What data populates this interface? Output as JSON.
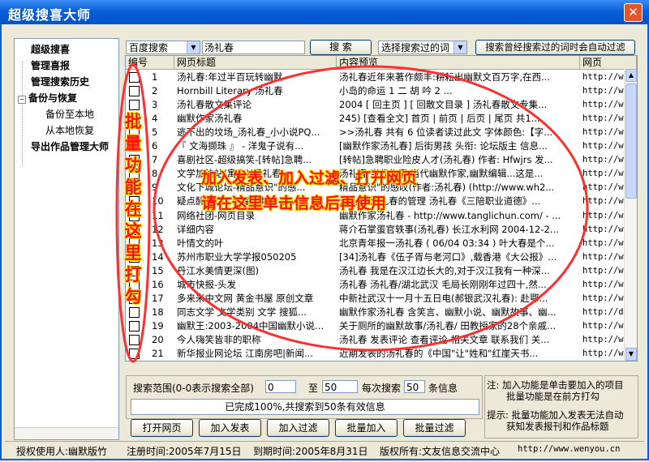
{
  "window": {
    "title": "超级搜喜大师",
    "close_symbol": "✕"
  },
  "sidebar": {
    "items": [
      {
        "label": "超级搜喜",
        "bold": true
      },
      {
        "label": "管理喜报",
        "bold": true
      },
      {
        "label": "管理搜索历史",
        "bold": true
      },
      {
        "label": "备份与恢复",
        "bold": true,
        "expander": "−"
      },
      {
        "label": "备份至本地",
        "bold": false
      },
      {
        "label": "从本地恢复",
        "bold": false
      },
      {
        "label": "导出作品管理大师",
        "bold": true
      }
    ]
  },
  "toolbar": {
    "engine": "百度搜索",
    "query": "汤礼春",
    "search_button": "搜 索",
    "history_select": "选择搜索过的词",
    "filter_button": "搜索曾经搜索过的词时会自动过滤"
  },
  "table": {
    "columns": [
      "编号",
      "网页标题",
      "内容预览",
      "网页"
    ],
    "rows": [
      {
        "n": "1",
        "title": "汤礼春:年过半百玩转幽默",
        "preview": "汤礼春近年来著作颇丰:耕耘出幽默文百万字,在西...",
        "url": "http://w"
      },
      {
        "n": "2",
        "title": "Hornbill Literary 汤礼春",
        "preview": "小岛的命运 1 二 胡 吟 2 ...",
        "url": "http://w"
      },
      {
        "n": "3",
        "title": "汤礼春散文集评论",
        "preview": "2004 [ 回主页 ] [ 回散文目录 ] 汤礼春散文专集...",
        "url": "http://w"
      },
      {
        "n": "4",
        "title": "幽默作家汤礼春",
        "preview": "245) [查看全文] 首页 | 前页 | 后页 | 尾页 共1...",
        "url": "http://w"
      },
      {
        "n": "5",
        "title": "逃不出的坟场_汤礼春_小小说PQ...",
        "preview": ">>汤礼春 共有 6 位读者读过此文 字体颜色:【字...",
        "url": "http://w"
      },
      {
        "n": "6",
        "title": "『 文海撷珠 』 - 洋鬼子说有...",
        "preview": "[幽默作家汤礼春] 后街男孩 头衔: 论坛版主 信息...",
        "url": "http://w"
      },
      {
        "n": "7",
        "title": "喜剧社区-超级搞笑-[转帖]急聘...",
        "preview": "[转帖]急聘职业险皮人才(汤礼春) 作者: Hfwjrs 发...",
        "url": "http://www.xijun..."
      },
      {
        "n": "8",
        "title": "文学加油站(寓言)(汤礼春)...",
        "preview": "汤礼春 当代作家,当代幽默作家,幽默编辑...这是...",
        "url": "http://w"
      },
      {
        "n": "9",
        "title": "文化下城论坛-精品意识\"的感...",
        "preview": "精品意识\"的感叹(作者:汤礼春) (http://www.wh2...",
        "url": "http://w"
      },
      {
        "n": "10",
        "title": "疑点醉吃之 - 红星论坛 - 汤...",
        "preview": "汤礼春 汤礼春的管理 汤礼春《三陪职业道德》...",
        "url": "http://w"
      },
      {
        "n": "11",
        "title": "网络社团-网页目录",
        "preview": "幽默作家汤礼春 - http://www.tanglichun.com/ - ...",
        "url": "http://w"
      },
      {
        "n": "12",
        "title": "详细内容",
        "preview": "蒋介石掌蛋官轶事(汤礼春) 长江水利网 2004-12-2...",
        "url": "http://w"
      },
      {
        "n": "13",
        "title": "叶情文的叶",
        "preview": "北京青年报一汤礼春 ( 06/04 03:34 ) 叶大春是个...",
        "url": "http://w"
      },
      {
        "n": "14",
        "title": "苏州市职业大学学报050205",
        "preview": "[34]汤礼春《伍子胥与老河口》,载香港《大公报》...",
        "url": "http://w"
      },
      {
        "n": "15",
        "title": "丹江水美情更深(图)",
        "preview": "汤礼春 我是在汉江边长大的,对于汉江我有一种深...",
        "url": "http://w"
      },
      {
        "n": "16",
        "title": "城市快报-头发",
        "preview": "汤礼春 汤礼春/湖北武汉 毛局长刚刚年过四十,然...",
        "url": "http://w"
      },
      {
        "n": "17",
        "title": "多来米中文网 黄金书屋 原创文章",
        "preview": "中新社武汉十一月十五日电(郝银武汉礼春): 赴鄂...",
        "url": "http://w"
      },
      {
        "n": "18",
        "title": "同志文学 文学类别 文学 搜狐...",
        "preview": "幽默作家汤礼春 含笑言、幽默小说、幽默故事、幽...",
        "url": "http://d"
      },
      {
        "n": "19",
        "title": "幽默王:2003-2004中国幽默小说...",
        "preview": "关于厕所的幽默故事/汤礼春/ 田教授家的28个亲戚...",
        "url": "http://w"
      },
      {
        "n": "20",
        "title": "今人嗨笑皆非的职称",
        "preview": "汤礼春 发表评论 查看评论 相关文章 联系我们 关...",
        "url": "http://w"
      },
      {
        "n": "21",
        "title": "新华报业网论坛 江南房吧|新闻...",
        "preview": "近期发表的汤礼春的《中国\"让\"姓和\"红崖天书...",
        "url": "http://w"
      }
    ]
  },
  "annotation": {
    "vertical_text": "批量功能在这里打勾",
    "line1": "加入发表、加入过滤、打开网页",
    "line2": "请在这里单击信息后再使用"
  },
  "range_panel": {
    "label_range": "搜索范围(0-0表示搜索全部)",
    "from_value": "0",
    "label_to": "至",
    "to_value": "50",
    "label_each": "每次搜索",
    "each_value": "50",
    "label_unit": "条信息",
    "progress_text": "已完成100%,共搜索到50条有效信息",
    "progress_percent": 100
  },
  "actions": {
    "open_page": "打开网页",
    "add_publish": "加入发表",
    "add_filter": "加入过滤",
    "batch_add": "批量加入",
    "batch_filter": "批量过滤"
  },
  "notes": {
    "note1": "注: 加入功能是单击要加入的项目",
    "note1b": "批量功能是在前方打勾",
    "note2": "提示: 批量功能加入发表无法自动",
    "note2b": "获知发表报刊和作品标题"
  },
  "statusbar": {
    "licensee": "授权使用人:幽默版竹",
    "registered": "注册时间:2005年7月15日",
    "expires": "到期时间:2005年8月31日",
    "copyright": "版权所有:文友信息交流中心",
    "site": "http://www.wenyou.cn"
  }
}
